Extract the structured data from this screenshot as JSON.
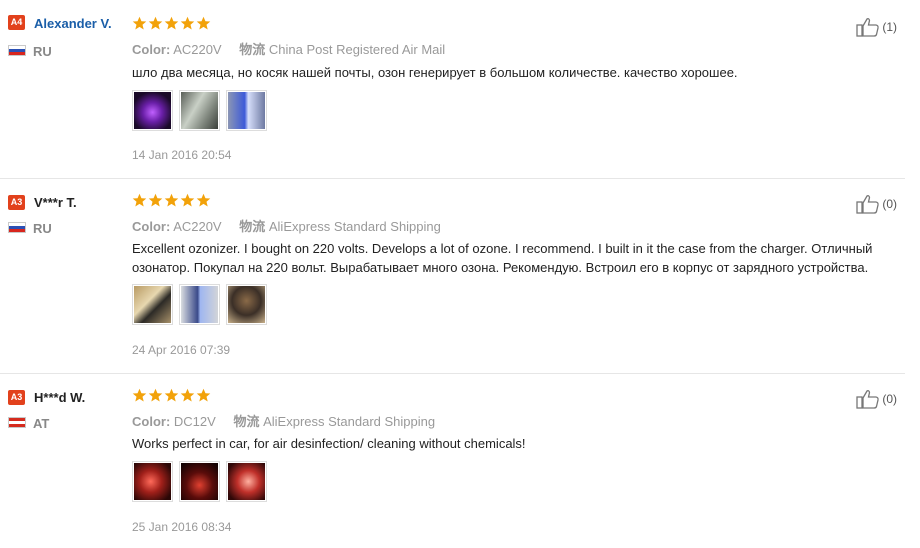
{
  "labels": {
    "color": "Color:",
    "shipping": "物流"
  },
  "reviews": [
    {
      "badge": "A4",
      "name": "Alexander V.",
      "country": "RU",
      "rating": 5,
      "color_value": "AC220V",
      "shipping_value": "China Post Registered Air Mail",
      "text": "шло два месяца, но косяк нашей почты, озон генерирует в большом количестве. качество хорошее.",
      "date": "14 Jan 2016 20:54",
      "useful_count": "(1)",
      "photos": [
        "photo-purple-glow",
        "photo-glass-tube",
        "photo-blue-tube"
      ]
    },
    {
      "badge": "A3",
      "name": "V***r T.",
      "country": "RU",
      "rating": 5,
      "color_value": "AC220V",
      "shipping_value": "AliExpress Standard Shipping",
      "text": "Excellent ozonizer. I bought on 220 volts. Develops a lot of ozone. I recommend. I built in it the case from the charger. Отличный озонатор. Покупал на 220 вольт. Вырабатывает много озона. Рекомендую. Встроил его в корпус от зарядного устройства.",
      "date": "24 Apr 2016 07:39",
      "useful_count": "(0)",
      "photos": [
        "photo-device-cable",
        "photo-blue-spark",
        "photo-charger-case"
      ]
    },
    {
      "badge": "A3",
      "name": "H***d W.",
      "country": "AT",
      "rating": 5,
      "color_value": "DC12V",
      "shipping_value": "AliExpress Standard Shipping",
      "text": "Works perfect in car, for air desinfection/ cleaning without chemicals!",
      "date": "25 Jan 2016 08:34",
      "useful_count": "(0)",
      "photos": [
        "photo-car-red-1",
        "photo-car-red-2",
        "photo-car-red-3"
      ]
    }
  ],
  "colors": {
    "badge": "#e2411c",
    "star": "#f2a20a",
    "name_link": "#1a5ea8",
    "muted": "#999999"
  }
}
